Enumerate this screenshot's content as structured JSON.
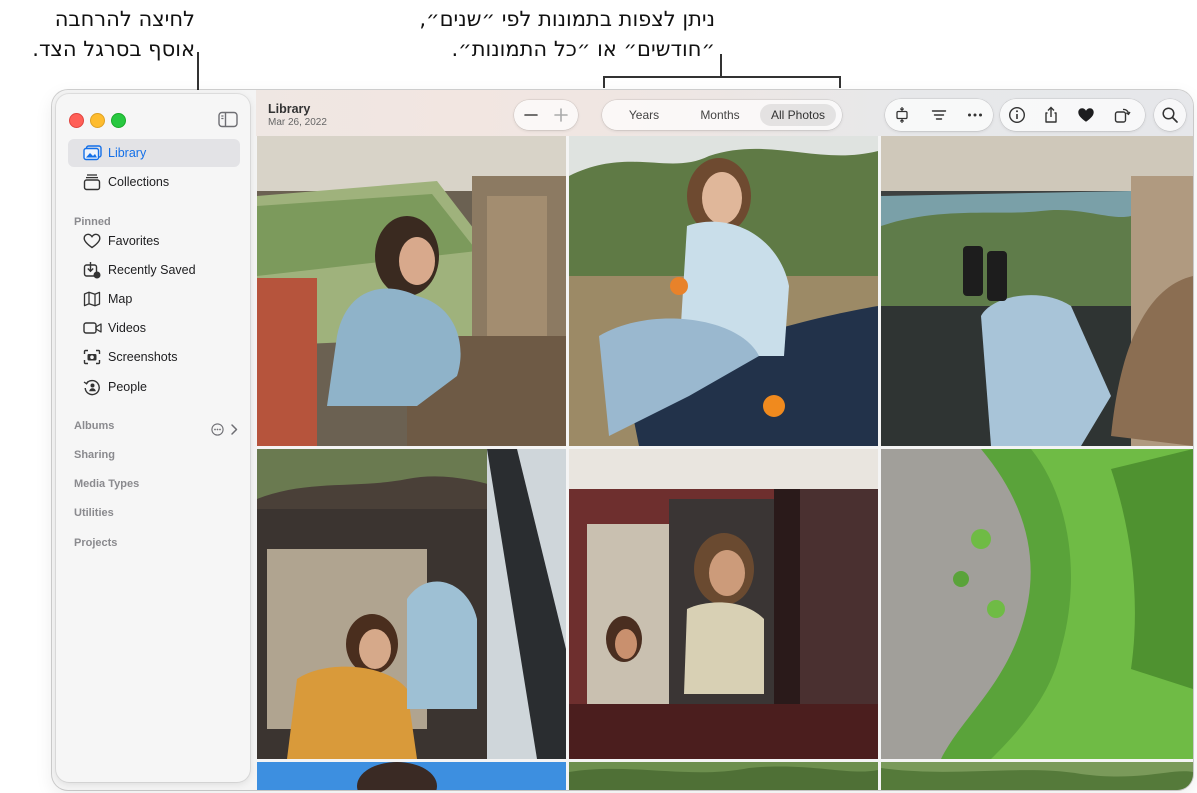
{
  "callouts": {
    "sidebar_hint": {
      "line1": "לחיצה להרחבה",
      "line2": "אוסף בסרגל הצד."
    },
    "view_hint": {
      "line1": "ניתן לצפות בתמונות לפי ״שנים״,",
      "line2": "״חודשים״ או ״כל התמונות״."
    }
  },
  "window": {
    "traffic_lights": [
      "close",
      "minimize",
      "zoom"
    ],
    "colors": {
      "close": "#ff5f57",
      "minimize": "#febc2e",
      "zoom": "#28c840",
      "accent": "#1470e8"
    }
  },
  "sidebar": {
    "toggle_icon": "sidebar-icon",
    "top_items": [
      {
        "label": "Library",
        "icon": "photo-library-icon",
        "selected": true
      },
      {
        "label": "Collections",
        "icon": "stack-icon",
        "selected": false
      }
    ],
    "pinned_header": "Pinned",
    "pinned_items": [
      {
        "label": "Favorites",
        "icon": "heart-icon"
      },
      {
        "label": "Recently Saved",
        "icon": "saved-icon"
      },
      {
        "label": "Map",
        "icon": "map-icon"
      },
      {
        "label": "Videos",
        "icon": "video-icon"
      },
      {
        "label": "Screenshots",
        "icon": "screenshot-icon"
      },
      {
        "label": "People",
        "icon": "people-icon"
      }
    ],
    "sections": [
      "Albums",
      "Sharing",
      "Media Types",
      "Utilities",
      "Projects"
    ]
  },
  "toolbar": {
    "title": "Library",
    "date": "Mar 26, 2022",
    "zoom_out_icon": "minus-icon",
    "zoom_in_icon": "plus-icon",
    "view_segments": [
      "Years",
      "Months",
      "All Photos"
    ],
    "selected_view": "All Photos",
    "tool_icons": [
      "aspect-icon",
      "filter-icon",
      "more-icon"
    ],
    "action_icons": [
      "info-icon",
      "share-icon",
      "heart-fill-icon",
      "rotate-icon"
    ],
    "search_icon": "search-icon"
  },
  "photos": [
    "girl-in-car-window",
    "girl-on-car-hood-orange",
    "feet-on-dashboard",
    "girls-in-car-back-seat",
    "woman-in-van-window",
    "ivy-on-stone-wall",
    "sky-portrait-partial",
    "trees-partial",
    "trees-partial-2"
  ]
}
